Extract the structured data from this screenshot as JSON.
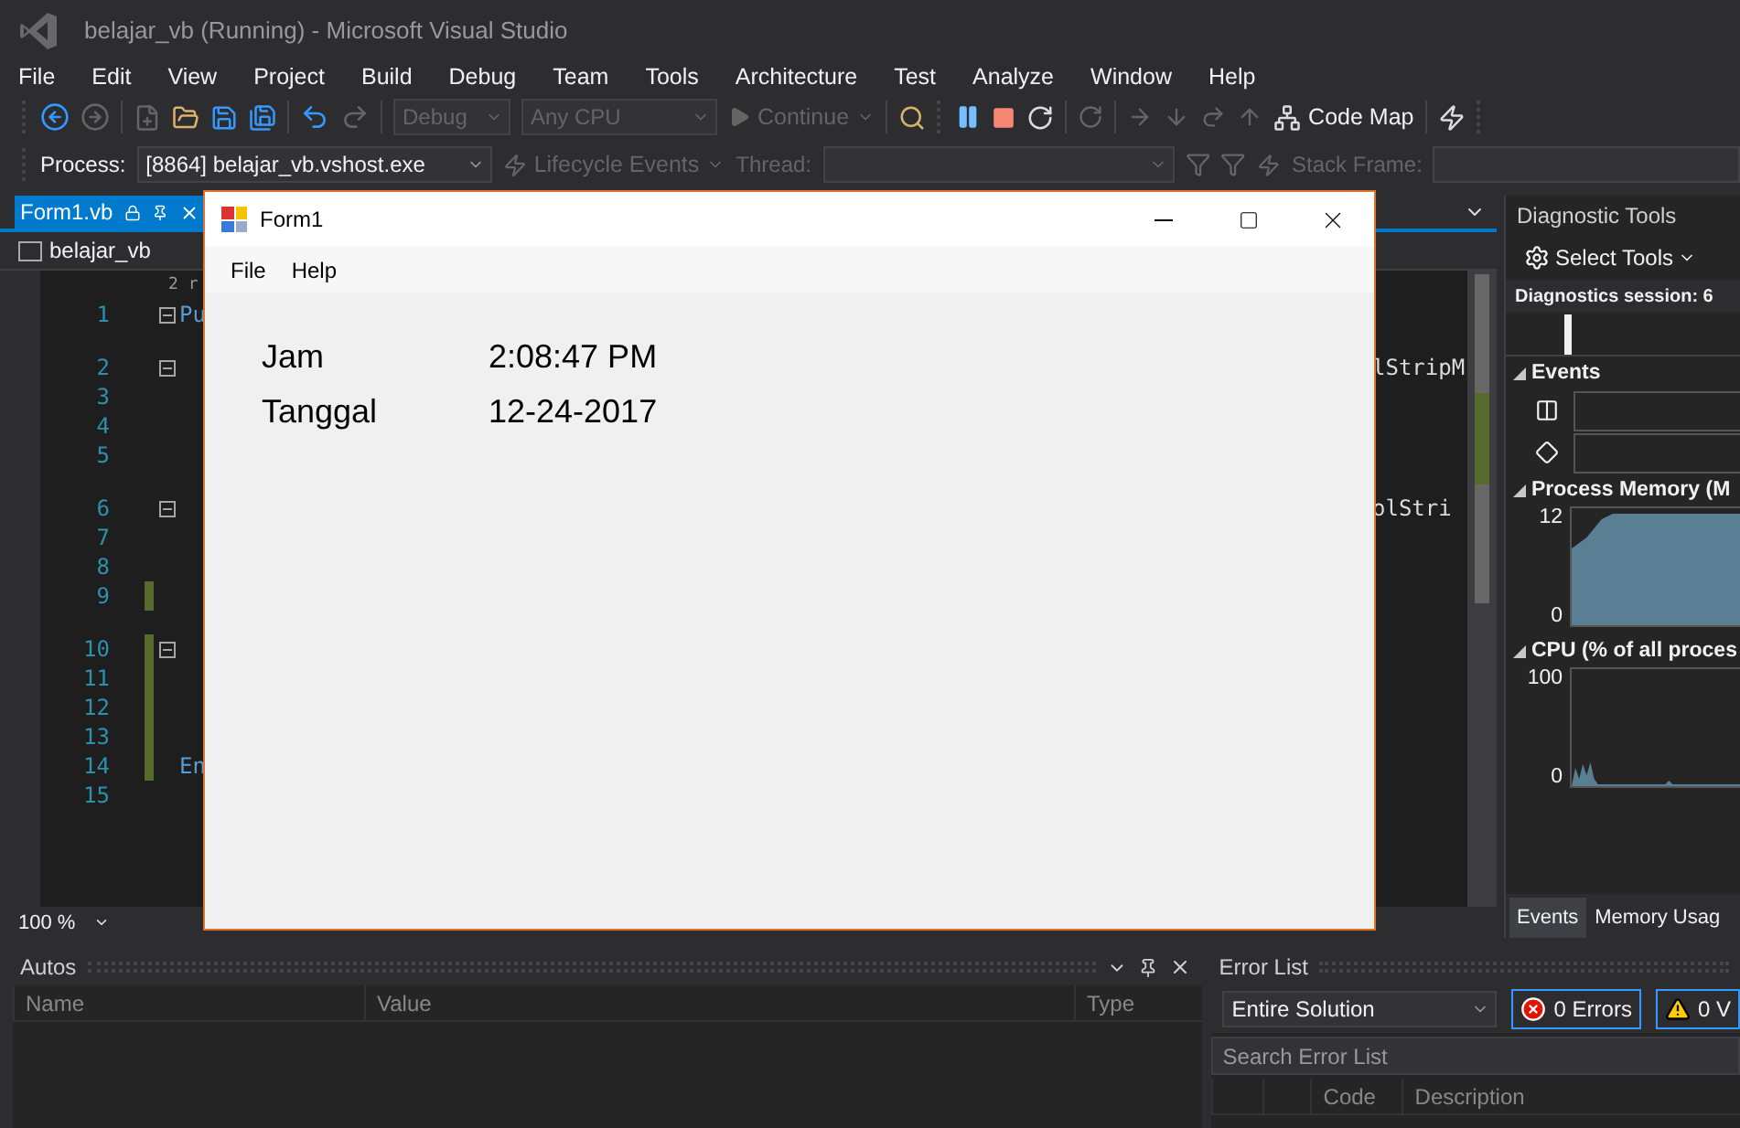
{
  "window": {
    "title": "belajar_vb (Running) - Microsoft Visual Studio"
  },
  "menu": [
    "File",
    "Edit",
    "View",
    "Project",
    "Build",
    "Debug",
    "Team",
    "Tools",
    "Architecture",
    "Test",
    "Analyze",
    "Window",
    "Help"
  ],
  "toolbar": {
    "config": "Debug",
    "platform": "Any CPU",
    "continue": "Continue",
    "code_map": "Code Map"
  },
  "debug_location": {
    "process_label": "Process:",
    "process": "[8864] belajar_vb.vshost.exe",
    "lifecycle": "Lifecycle Events",
    "thread_label": "Thread:",
    "stack_label": "Stack Frame:"
  },
  "editor": {
    "tabs": [
      {
        "label": "Form1.vb",
        "selected": true
      }
    ],
    "nav": "belajar_vb",
    "codelens": "2 r",
    "zoom": "100 %",
    "lines": [
      {
        "number": "1",
        "text": "Pu",
        "fold": true,
        "lens": false,
        "changed": false
      },
      {
        "number": "2",
        "tail": "lStripM",
        "fold": true,
        "lens": true,
        "changed": false
      },
      {
        "number": "3",
        "fold": false,
        "lens": false,
        "changed": false
      },
      {
        "number": "4",
        "fold": false,
        "lens": false,
        "changed": false
      },
      {
        "number": "5",
        "fold": false,
        "lens": false,
        "changed": false
      },
      {
        "number": "6",
        "tail": "olStri",
        "fold": true,
        "lens": true,
        "changed": false
      },
      {
        "number": "7",
        "fold": false,
        "lens": false,
        "changed": false
      },
      {
        "number": "8",
        "fold": false,
        "lens": false,
        "changed": false
      },
      {
        "number": "9",
        "fold": false,
        "lens": false,
        "changed": true
      },
      {
        "number": "10",
        "fold": true,
        "lens": true,
        "changed": true
      },
      {
        "number": "11",
        "fold": false,
        "lens": false,
        "changed": true
      },
      {
        "number": "12",
        "fold": false,
        "lens": false,
        "changed": true
      },
      {
        "number": "13",
        "fold": false,
        "lens": false,
        "changed": true
      },
      {
        "number": "14",
        "text": "En",
        "fold": false,
        "lens": false,
        "changed": true
      },
      {
        "number": "15",
        "fold": false,
        "lens": false,
        "changed": false
      }
    ]
  },
  "diagnostics": {
    "title": "Diagnostic Tools",
    "select_tools": "Select Tools",
    "session": "Diagnostics session: 6",
    "events": "Events",
    "memory": "Process Memory (M",
    "memory_max": "12",
    "memory_min": "0",
    "cpu": "CPU (% of all proces",
    "cpu_max": "100",
    "cpu_min": "0",
    "tabs": [
      {
        "label": "Events",
        "selected": true
      },
      {
        "label": "Memory Usag",
        "selected": false
      }
    ]
  },
  "autos": {
    "title": "Autos",
    "columns": [
      "Name",
      "Value",
      "Type"
    ]
  },
  "error_list": {
    "title": "Error List",
    "scope": "Entire Solution",
    "errors": "0 Errors",
    "warnings": "0 V",
    "search": {
      "placeholder": "Search Error List"
    },
    "columns": [
      "Code",
      "Description"
    ]
  },
  "form": {
    "title": "Form1",
    "menu": [
      "File",
      "Help"
    ],
    "fields": [
      {
        "label": "Jam",
        "value": "2:08:47 PM"
      },
      {
        "label": "Tanggal",
        "value": "12-24-2017"
      }
    ]
  }
}
